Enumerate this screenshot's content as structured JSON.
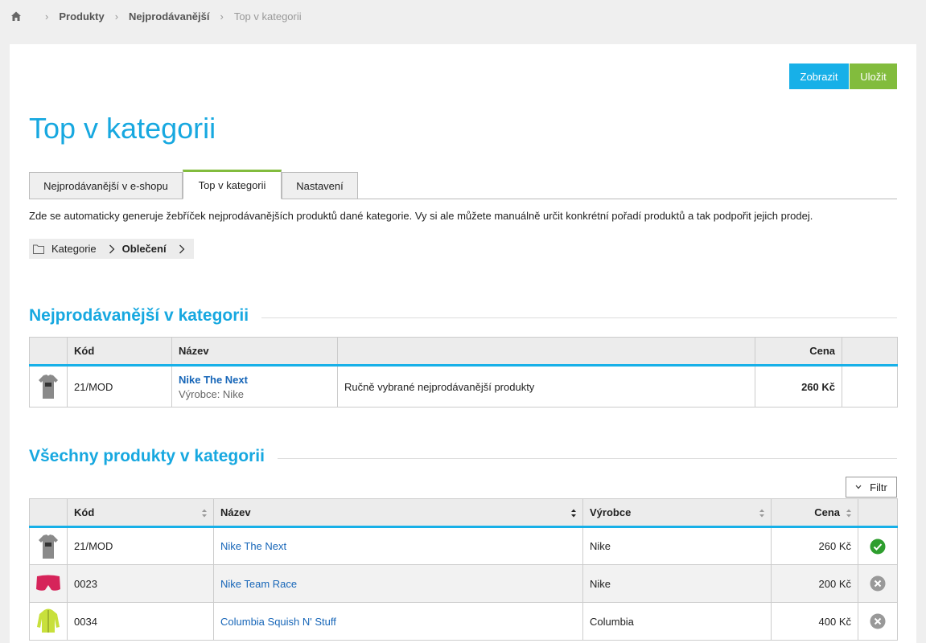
{
  "breadcrumb": {
    "items": [
      "Produkty",
      "Nejprodávanější"
    ],
    "current": "Top v kategorii"
  },
  "actions": {
    "show_label": "Zobrazit",
    "save_label": "Uložit"
  },
  "page_title": "Top v kategorii",
  "tabs": [
    {
      "label": "Nejprodávanější v e-shopu"
    },
    {
      "label": "Top v kategorii"
    },
    {
      "label": "Nastavení"
    }
  ],
  "intro": "Zde se automaticky generuje žebříček nejprodávanějších produktů dané kategorie. Vy si ale můžete manuálně určit konkrétní pořadí produktů a tak podpořit jejich prodej.",
  "category_path": {
    "root": "Kategorie",
    "current": "Oblečení"
  },
  "bestsellers": {
    "title": "Nejprodávanější v kategorii",
    "columns": {
      "code": "Kód",
      "name": "Název",
      "price": "Cena"
    },
    "rows": [
      {
        "code": "21/MOD",
        "name": "Nike The Next",
        "maker": "Výrobce: Nike",
        "note": "Ručně vybrané nejprodávanější produkty",
        "price": "260 Kč"
      }
    ]
  },
  "all_products": {
    "title": "Všechny produkty v kategorii",
    "filter_label": "Filtr",
    "columns": {
      "code": "Kód",
      "name": "Název",
      "maker": "Výrobce",
      "price": "Cena"
    },
    "rows": [
      {
        "code": "21/MOD",
        "name": "Nike The Next",
        "maker": "Nike",
        "price": "260 Kč",
        "status": "check-icon"
      },
      {
        "code": "0023",
        "name": "Nike Team Race",
        "maker": "Nike",
        "price": "200 Kč",
        "status": "remove-icon"
      },
      {
        "code": "0034",
        "name": "Columbia Squish N' Stuff",
        "maker": "Columbia",
        "price": "400 Kč",
        "status": "remove-icon"
      }
    ]
  },
  "colors": {
    "accent": "#17b0e8",
    "save": "#82bc3d",
    "title": "#17a8e0",
    "link": "#1766b8"
  }
}
